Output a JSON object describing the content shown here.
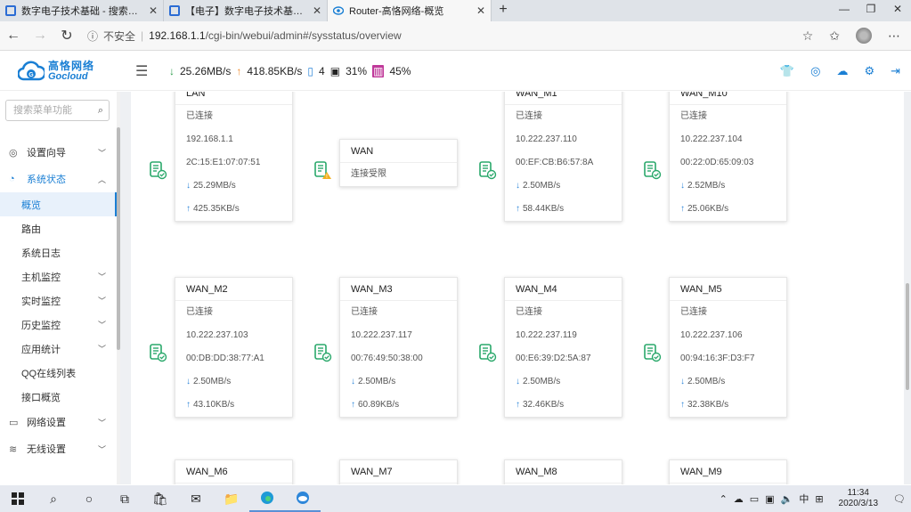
{
  "browser": {
    "tabs": [
      {
        "title": "数字电子技术基础 - 搜索结果 - M",
        "favicon_color": "#2b6cd4"
      },
      {
        "title": "【电子】数字电子技术基础 清华",
        "favicon_color": "#2b6cd4"
      },
      {
        "title": "Router-高恪网络-概览",
        "favicon_color": "#1a7fd4"
      }
    ],
    "new_tab": "+",
    "security_label": "不安全",
    "url_host": "192.168.1.1",
    "url_path": "/cgi-bin/webui/admin#/sysstatus/overview"
  },
  "app": {
    "logo_cn": "高恪网络",
    "logo_en": "Gocloud",
    "stats": {
      "download": "25.26MB/s",
      "upload": "418.85KB/s",
      "devices": "4",
      "cpu": "31%",
      "mem": "45%"
    },
    "accent": "#1a7fd4"
  },
  "sidebar": {
    "search_placeholder": "搜索菜单功能",
    "items": [
      {
        "label": "设置向导",
        "icon": "compass-icon",
        "caret": "⌄",
        "type": "top"
      },
      {
        "label": "系统状态",
        "icon": "dashboard-icon",
        "caret": "⌃",
        "type": "open"
      },
      {
        "label": "概览",
        "type": "active"
      },
      {
        "label": "路由",
        "type": "sub"
      },
      {
        "label": "系统日志",
        "type": "sub"
      },
      {
        "label": "主机监控",
        "caret": "⌄",
        "type": "sub"
      },
      {
        "label": "实时监控",
        "caret": "⌄",
        "type": "sub"
      },
      {
        "label": "历史监控",
        "caret": "⌄",
        "type": "sub"
      },
      {
        "label": "应用统计",
        "caret": "⌄",
        "type": "sub"
      },
      {
        "label": "QQ在线列表",
        "type": "sub"
      },
      {
        "label": "接口概览",
        "type": "sub"
      },
      {
        "label": "网络设置",
        "icon": "monitor-icon",
        "caret": "⌄",
        "type": "top"
      },
      {
        "label": "无线设置",
        "icon": "wifi-icon",
        "caret": "⌄",
        "type": "top"
      }
    ]
  },
  "interfaces": [
    {
      "name": "LAN",
      "status": "已连接",
      "ip": "192.168.1.1",
      "mac": "2C:15:E1:07:07:51",
      "down": "25.29MB/s",
      "up": "425.35KB/s",
      "state": "ok"
    },
    {
      "name": "WAN",
      "status": "连接受限",
      "state": "warn"
    },
    {
      "name": "WAN_M1",
      "status": "已连接",
      "ip": "10.222.237.110",
      "mac": "00:EF:CB:B6:57:8A",
      "down": "2.50MB/s",
      "up": "58.44KB/s",
      "state": "ok"
    },
    {
      "name": "WAN_M10",
      "status": "已连接",
      "ip": "10.222.237.104",
      "mac": "00:22:0D:65:09:03",
      "down": "2.52MB/s",
      "up": "25.06KB/s",
      "state": "ok"
    },
    {
      "name": "WAN_M2",
      "status": "已连接",
      "ip": "10.222.237.103",
      "mac": "00:DB:DD:38:77:A1",
      "down": "2.50MB/s",
      "up": "43.10KB/s",
      "state": "ok"
    },
    {
      "name": "WAN_M3",
      "status": "已连接",
      "ip": "10.222.237.117",
      "mac": "00:76:49:50:38:00",
      "down": "2.50MB/s",
      "up": "60.89KB/s",
      "state": "ok"
    },
    {
      "name": "WAN_M4",
      "status": "已连接",
      "ip": "10.222.237.119",
      "mac": "00:E6:39:D2:5A:87",
      "down": "2.50MB/s",
      "up": "32.46KB/s",
      "state": "ok"
    },
    {
      "name": "WAN_M5",
      "status": "已连接",
      "ip": "10.222.237.106",
      "mac": "00:94:16:3F:D3:F7",
      "down": "2.50MB/s",
      "up": "32.38KB/s",
      "state": "ok"
    },
    {
      "name": "WAN_M6",
      "state": "ok"
    },
    {
      "name": "WAN_M7",
      "state": "ok"
    },
    {
      "name": "WAN_M8",
      "state": "ok"
    },
    {
      "name": "WAN_M9",
      "state": "ok"
    }
  ],
  "taskbar": {
    "ime": "中",
    "time": "11:34",
    "date": "2020/3/13"
  }
}
